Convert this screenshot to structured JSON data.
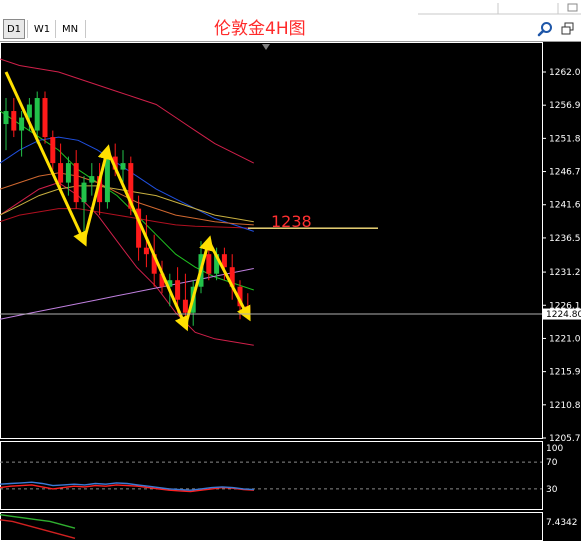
{
  "toolbar": {
    "timeframes": [
      "D1",
      "W1",
      "MN"
    ],
    "selected": "D1"
  },
  "title": "伦敦金4H图",
  "annotations": {
    "resistance_label": "1238"
  },
  "icons": {
    "search": "search-icon",
    "restore": "restore-window-icon"
  },
  "colors": {
    "background": "#000000",
    "bull_candle": "#22c24a",
    "bear_candle": "#ff1a1a",
    "arrow": "#ffe000",
    "title": "#ff2a2a"
  },
  "chart_data": [
    {
      "type": "candlestick",
      "symbol_label": "伦敦金4H图",
      "price_axis_ticks": [
        "1262.00",
        "1256.90",
        "1251.80",
        "1246.70",
        "1241.60",
        "1236.50",
        "1231.25",
        "1226.15",
        "1221.05",
        "1215.95",
        "1210.85",
        "1205.75"
      ],
      "current_price": "1224.80",
      "ylim": [
        1205.75,
        1262.0
      ],
      "resistance_level": 1238,
      "candles": [
        {
          "o": 1254,
          "h": 1258,
          "l": 1250,
          "c": 1256
        },
        {
          "o": 1256,
          "h": 1258,
          "l": 1252,
          "c": 1253
        },
        {
          "o": 1253,
          "h": 1256,
          "l": 1249,
          "c": 1255
        },
        {
          "o": 1255,
          "h": 1258,
          "l": 1253,
          "c": 1257
        },
        {
          "o": 1253,
          "h": 1259,
          "l": 1251,
          "c": 1258
        },
        {
          "o": 1258,
          "h": 1259,
          "l": 1251,
          "c": 1252
        },
        {
          "o": 1252,
          "h": 1253,
          "l": 1247,
          "c": 1248
        },
        {
          "o": 1248,
          "h": 1251,
          "l": 1244,
          "c": 1245
        },
        {
          "o": 1245,
          "h": 1249,
          "l": 1243,
          "c": 1248
        },
        {
          "o": 1248,
          "h": 1250,
          "l": 1241,
          "c": 1242
        },
        {
          "o": 1242,
          "h": 1246,
          "l": 1236,
          "c": 1245
        },
        {
          "o": 1245,
          "h": 1248,
          "l": 1243,
          "c": 1246
        },
        {
          "o": 1246,
          "h": 1248,
          "l": 1240,
          "c": 1242
        },
        {
          "o": 1242,
          "h": 1250,
          "l": 1241,
          "c": 1249
        },
        {
          "o": 1249,
          "h": 1251,
          "l": 1246,
          "c": 1247
        },
        {
          "o": 1247,
          "h": 1250,
          "l": 1245,
          "c": 1248
        },
        {
          "o": 1248,
          "h": 1249,
          "l": 1240,
          "c": 1241
        },
        {
          "o": 1241,
          "h": 1243,
          "l": 1233,
          "c": 1235
        },
        {
          "o": 1235,
          "h": 1240,
          "l": 1232,
          "c": 1234
        },
        {
          "o": 1234,
          "h": 1237,
          "l": 1229,
          "c": 1231
        },
        {
          "o": 1231,
          "h": 1233,
          "l": 1228,
          "c": 1229
        },
        {
          "o": 1229,
          "h": 1231,
          "l": 1226,
          "c": 1230
        },
        {
          "o": 1230,
          "h": 1232,
          "l": 1225,
          "c": 1227
        },
        {
          "o": 1227,
          "h": 1231,
          "l": 1223,
          "c": 1225
        },
        {
          "o": 1225,
          "h": 1230,
          "l": 1223,
          "c": 1229
        },
        {
          "o": 1229,
          "h": 1236,
          "l": 1228,
          "c": 1234
        },
        {
          "o": 1234,
          "h": 1236,
          "l": 1230,
          "c": 1231
        },
        {
          "o": 1231,
          "h": 1235,
          "l": 1230,
          "c": 1234
        },
        {
          "o": 1234,
          "h": 1235,
          "l": 1230,
          "c": 1232
        },
        {
          "o": 1232,
          "h": 1234,
          "l": 1227,
          "c": 1229
        },
        {
          "o": 1229,
          "h": 1230,
          "l": 1224,
          "c": 1226
        },
        {
          "o": 1226,
          "h": 1228,
          "l": 1224,
          "c": 1225
        }
      ],
      "overlays": [
        {
          "name": "upper_band",
          "color": "#d0204a",
          "values": [
            1264,
            1263,
            1262.5,
            1262,
            1261,
            1260,
            1259,
            1258,
            1257,
            1255,
            1253,
            1251,
            1249.5,
            1248
          ]
        },
        {
          "name": "lower_band",
          "color": "#d0204a",
          "values": [
            1240,
            1242,
            1244,
            1245,
            1243,
            1240,
            1236,
            1232,
            1229,
            1225,
            1222,
            1221,
            1220.5,
            1220
          ]
        },
        {
          "name": "ma_mid",
          "color": "#b01020",
          "values": [
            1239,
            1240,
            1240.5,
            1241,
            1241,
            1240.5,
            1240,
            1239.5,
            1239,
            1238.5,
            1238.3,
            1238.2,
            1238.1,
            1238
          ]
        },
        {
          "name": "ma_fast",
          "color": "#20c020",
          "values": [
            1256,
            1254,
            1252,
            1250,
            1247,
            1245,
            1243,
            1240,
            1237,
            1234,
            1232,
            1230.5,
            1229.5,
            1228.5
          ]
        },
        {
          "name": "ma_blue",
          "color": "#2050e0",
          "values": [
            1248,
            1250,
            1251.5,
            1252,
            1251.5,
            1250,
            1248,
            1246,
            1244,
            1242.5,
            1241,
            1239.5,
            1238.5,
            1237.5
          ]
        },
        {
          "name": "ma_yellow",
          "color": "#c8b040",
          "values": [
            1240,
            1241.5,
            1243,
            1244,
            1244.5,
            1244.5,
            1244,
            1243.5,
            1243,
            1242,
            1241,
            1240,
            1239.5,
            1239
          ]
        },
        {
          "name": "ma_orange",
          "color": "#d06830",
          "values": [
            1244,
            1245,
            1246,
            1246.5,
            1246,
            1245,
            1243.5,
            1242,
            1241,
            1240,
            1239.5,
            1239,
            1238.7,
            1238.5
          ]
        },
        {
          "name": "ma_violet",
          "color": "#c080e0",
          "values": [
            1224,
            1224.6,
            1225.2,
            1225.8,
            1226.4,
            1227,
            1227.6,
            1228.2,
            1228.8,
            1229.4,
            1230,
            1230.6,
            1231.2,
            1231.8
          ]
        }
      ],
      "wave_points": [
        {
          "i": 0,
          "p": 1262
        },
        {
          "i": 10,
          "p": 1236
        },
        {
          "i": 13,
          "p": 1250
        },
        {
          "i": 23,
          "p": 1223
        },
        {
          "i": 26,
          "p": 1236
        },
        {
          "i": 31,
          "p": 1224.5
        }
      ]
    },
    {
      "type": "line",
      "name": "oscillator",
      "levels": [
        "100",
        "70",
        "30"
      ],
      "ylim": [
        0,
        100
      ],
      "series": [
        {
          "color": "#ff2020",
          "values": [
            32,
            34,
            35,
            36,
            33,
            30,
            32,
            34,
            33,
            35,
            34,
            36,
            35,
            34,
            32,
            30,
            28,
            27,
            26,
            28,
            30,
            32,
            31,
            29,
            28
          ]
        },
        {
          "color": "#3a7ad6",
          "values": [
            37,
            38,
            39,
            40,
            38,
            35,
            36,
            37,
            36,
            38,
            37,
            39,
            38,
            36,
            34,
            32,
            30,
            29,
            28,
            30,
            32,
            33,
            32,
            30,
            29
          ]
        }
      ]
    },
    {
      "type": "line",
      "name": "lower_indicator",
      "levels": [
        "7.4342"
      ],
      "series": [
        {
          "color": "#2fae2f",
          "values": [
            7.43,
            7.42,
            7.41,
            7.4,
            7.39,
            7.37,
            7.35
          ]
        },
        {
          "color": "#d02020",
          "values": [
            7.4,
            7.39,
            7.37,
            7.35,
            7.33,
            7.31,
            7.29
          ]
        }
      ]
    }
  ]
}
